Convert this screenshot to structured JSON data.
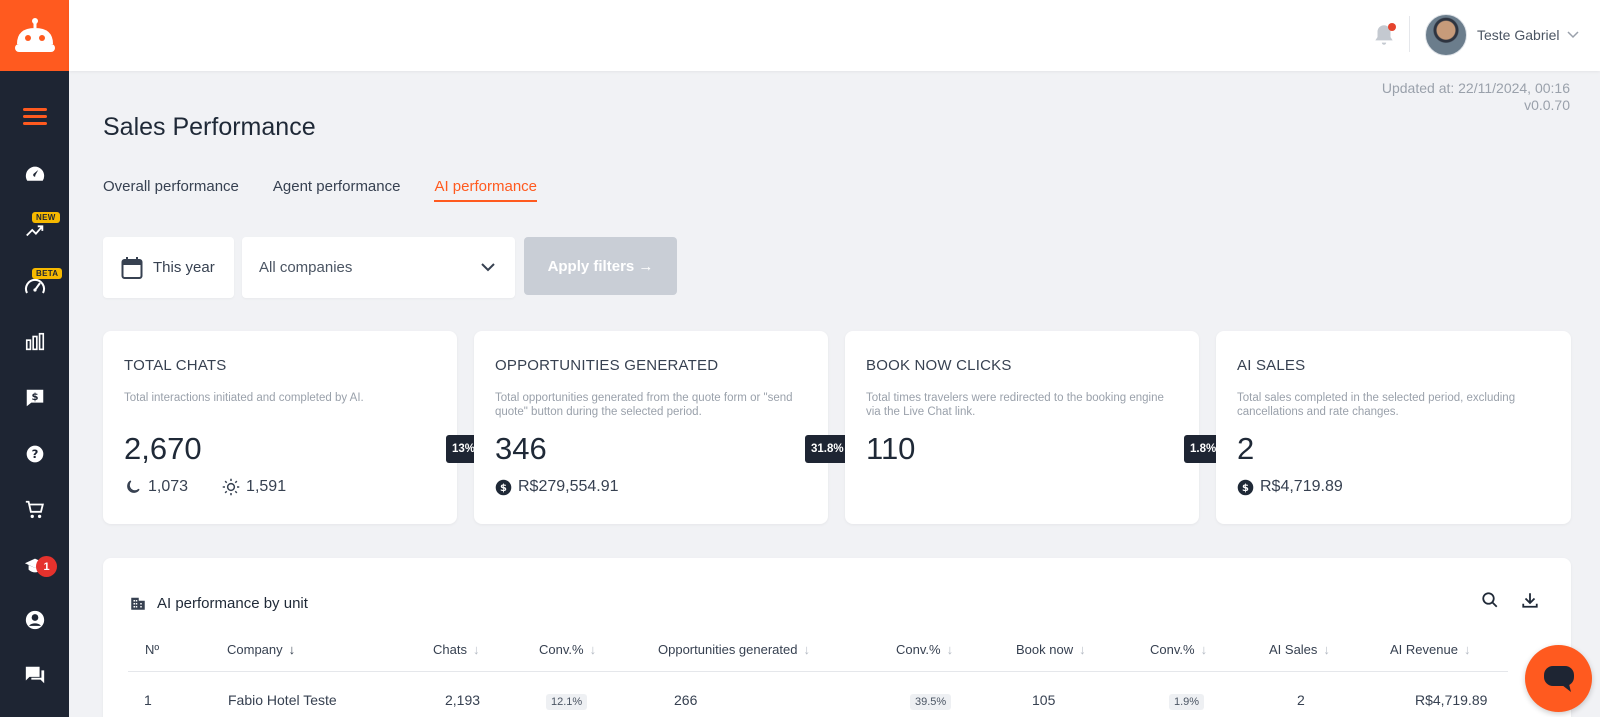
{
  "user": {
    "name": "Teste Gabriel"
  },
  "sidebar": {
    "badges": {
      "new": "NEW",
      "beta": "BETA",
      "academy_count": "1"
    }
  },
  "meta": {
    "updated_at": "Updated at: 22/11/2024, 00:16",
    "version": "v0.0.70"
  },
  "page": {
    "title": "Sales Performance"
  },
  "tabs": [
    {
      "label": "Overall performance"
    },
    {
      "label": "Agent performance"
    },
    {
      "label": "AI performance"
    }
  ],
  "filters": {
    "date_label": "This year",
    "company_label": "All companies",
    "apply_label": "Apply filters →"
  },
  "cards": [
    {
      "title": "TOTAL CHATS",
      "desc": "Total interactions initiated and completed by AI.",
      "value": "2,670",
      "night": "1,073",
      "day": "1,591"
    },
    {
      "title": "OPPORTUNITIES GENERATED",
      "desc": "Total opportunities generated from the quote form or \"send quote\" button during the selected period.",
      "value": "346",
      "amount": "R$279,554.91",
      "conv": "13%"
    },
    {
      "title": "BOOK NOW CLICKS",
      "desc": "Total times travelers were redirected to the booking engine via the Live Chat link.",
      "value": "110",
      "conv": "31.8%"
    },
    {
      "title": "AI SALES",
      "desc": "Total sales completed in the selected period, excluding cancellations and rate changes.",
      "value": "2",
      "amount": "R$4,719.89",
      "conv": "1.8%"
    }
  ],
  "table": {
    "title": "AI performance by unit",
    "columns": [
      "Nº",
      "Company",
      "Chats",
      "Conv.%",
      "Opportunities generated",
      "Conv.%",
      "Book now",
      "Conv.%",
      "AI Sales",
      "AI Revenue"
    ],
    "rows": [
      {
        "n": "1",
        "company": "Fabio Hotel Teste",
        "chats": "2,193",
        "conv1": "12.1%",
        "opps": "266",
        "conv2": "39.5%",
        "book": "105",
        "conv3": "1.9%",
        "sales": "2",
        "revenue": "R$4,719.89"
      }
    ]
  },
  "colors": {
    "accent": "#ff5a1f",
    "sidebar": "#1e2533",
    "background": "#f1f2f5"
  }
}
